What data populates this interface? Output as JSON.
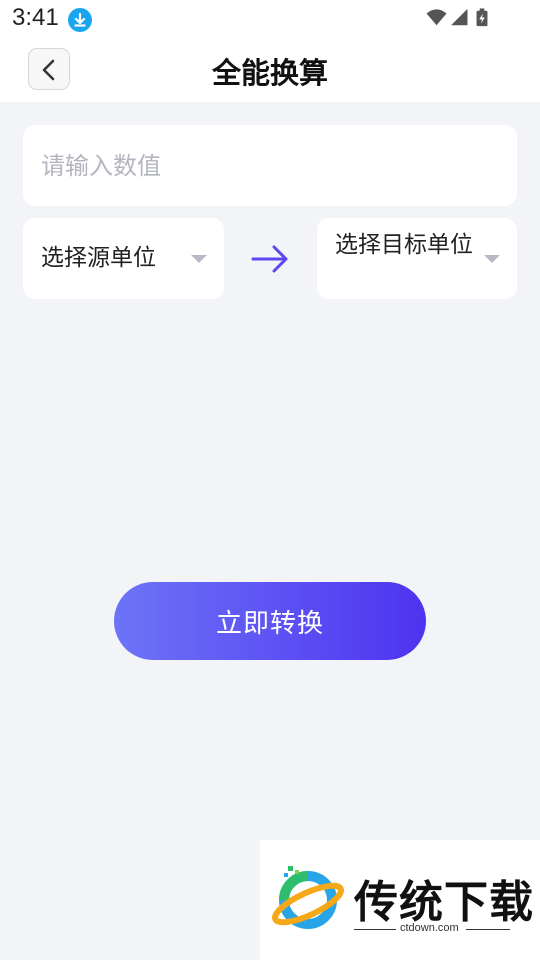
{
  "status_bar": {
    "time": "3:41",
    "icons": [
      "download-icon",
      "wifi-icon",
      "signal-icon",
      "battery-icon"
    ]
  },
  "app_bar": {
    "title": "全能换算",
    "back_icon": "chevron-left-icon"
  },
  "converter": {
    "value_placeholder": "请输入数值",
    "value": "",
    "source_unit_label": "选择源单位",
    "target_unit_label": "选择目标单位",
    "arrow_icon": "arrow-right-icon",
    "convert_button_label": "立即转换"
  },
  "watermark": {
    "brand": "传统下载",
    "domain": "ctdown.com"
  },
  "colors": {
    "accent": "#5b47f2",
    "gradient_start": "#6d74f7",
    "gradient_end": "#4e33f0",
    "background": "#f3f4f8",
    "download_badge": "#1aa6ee"
  }
}
